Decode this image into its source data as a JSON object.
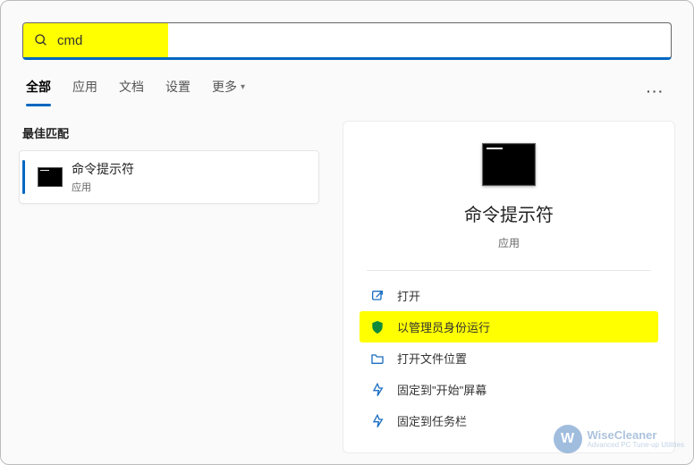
{
  "search": {
    "query": "cmd"
  },
  "tabs": {
    "items": [
      "全部",
      "应用",
      "文档",
      "设置",
      "更多"
    ],
    "active_index": 0
  },
  "results": {
    "section_title": "最佳匹配",
    "top": {
      "title": "命令提示符",
      "subtitle": "应用"
    }
  },
  "preview": {
    "title": "命令提示符",
    "subtitle": "应用",
    "actions": {
      "open": "打开",
      "run_admin": "以管理员身份运行",
      "open_location": "打开文件位置",
      "pin_start": "固定到\"开始\"屏幕",
      "pin_taskbar": "固定到任务栏"
    }
  },
  "watermark": {
    "brand": "WiseCleaner",
    "tagline": "Advanced PC Tune-up Utilities"
  }
}
